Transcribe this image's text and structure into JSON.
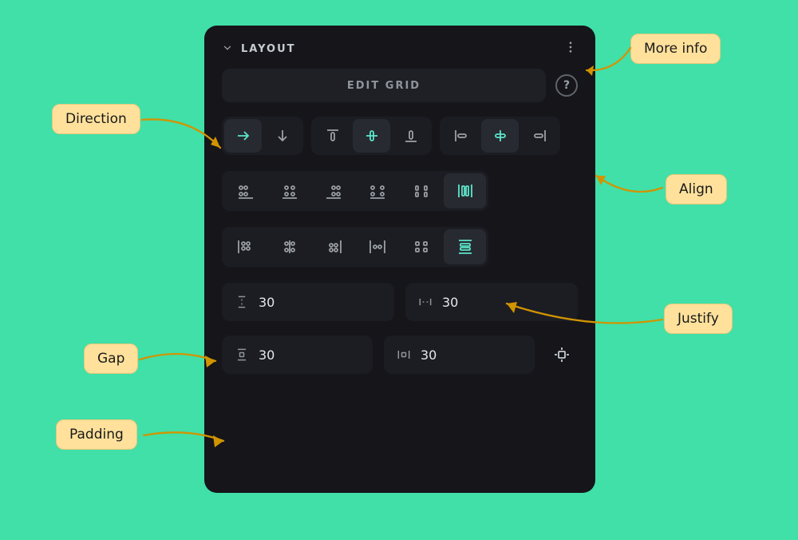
{
  "header": {
    "title": "LAYOUT"
  },
  "editGrid": {
    "label": "EDIT GRID"
  },
  "gap": {
    "row": "30",
    "column": "30"
  },
  "padding": {
    "vertical": "30",
    "horizontal": "30"
  },
  "callouts": {
    "moreInfo": "More info",
    "direction": "Direction",
    "align": "Align",
    "justify": "Justify",
    "gap": "Gap",
    "padding": "Padding"
  }
}
